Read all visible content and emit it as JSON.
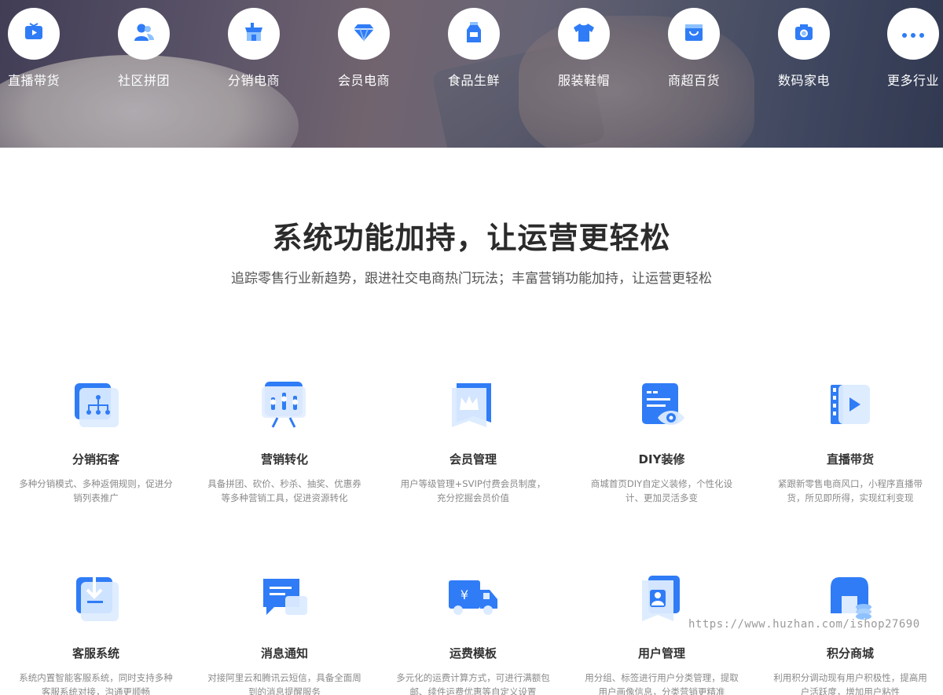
{
  "banner": {
    "industries": [
      {
        "label": "直播带货",
        "icon": "tv-play-icon"
      },
      {
        "label": "社区拼团",
        "icon": "users-icon"
      },
      {
        "label": "分销电商",
        "icon": "storefront-icon"
      },
      {
        "label": "会员电商",
        "icon": "diamond-icon"
      },
      {
        "label": "食品生鲜",
        "icon": "milk-bottle-icon"
      },
      {
        "label": "服装鞋帽",
        "icon": "tshirt-icon"
      },
      {
        "label": "商超百货",
        "icon": "shopping-bag-icon"
      },
      {
        "label": "数码家电",
        "icon": "camera-icon"
      },
      {
        "label": "更多行业",
        "icon": "more-dots-icon"
      }
    ]
  },
  "section": {
    "title": "系统功能加持，让运营更轻松",
    "subtitle": "追踪零售行业新趋势，跟进社交电商热门玩法；丰富营销功能加持，让运营更轻松"
  },
  "features": [
    {
      "title": "分销拓客",
      "desc": "多种分销模式、多种返佣规则，促进分销列表推广",
      "icon": "distribution-tree-icon"
    },
    {
      "title": "营销转化",
      "desc": "具备拼团、砍价、秒杀、抽奖、优惠券等多种营销工具，促进资源转化",
      "icon": "marketing-board-icon"
    },
    {
      "title": "会员管理",
      "desc": "用户等级管理+SVIP付费会员制度，充分挖掘会员价值",
      "icon": "crown-icon"
    },
    {
      "title": "DIY装修",
      "desc": "商城首页DIY自定义装修，个性化设计、更加灵活多变",
      "icon": "page-eye-icon"
    },
    {
      "title": "直播带货",
      "desc": "紧跟新零售电商风口，小程序直播带货，所见即所得，实现红利变现",
      "icon": "film-play-icon"
    },
    {
      "title": "客服系统",
      "desc": "系统内置智能客服系统，同时支持多种客服系统对接，沟通更顺畅",
      "icon": "download-box-icon"
    },
    {
      "title": "消息通知",
      "desc": "对接阿里云和腾讯云短信，具备全面周到的消息提醒服务",
      "icon": "chat-bubble-icon"
    },
    {
      "title": "运费模板",
      "desc": "多元化的运费计算方式，可进行满额包邮、续件运费优惠等自定义设置",
      "icon": "delivery-truck-icon"
    },
    {
      "title": "用户管理",
      "desc": "用分组、标签进行用户分类管理，提取用户画像信息，分类营销更精准",
      "icon": "user-card-icon"
    },
    {
      "title": "积分商城",
      "desc": "利用积分调动现有用户积极性，提高用户活跃度，增加用户粘性",
      "icon": "shop-coins-icon"
    }
  ],
  "watermark": "https://www.huzhan.com/ishop27690",
  "colors": {
    "accent": "#2f7cf6",
    "accent_light": "#8ec1ff"
  }
}
